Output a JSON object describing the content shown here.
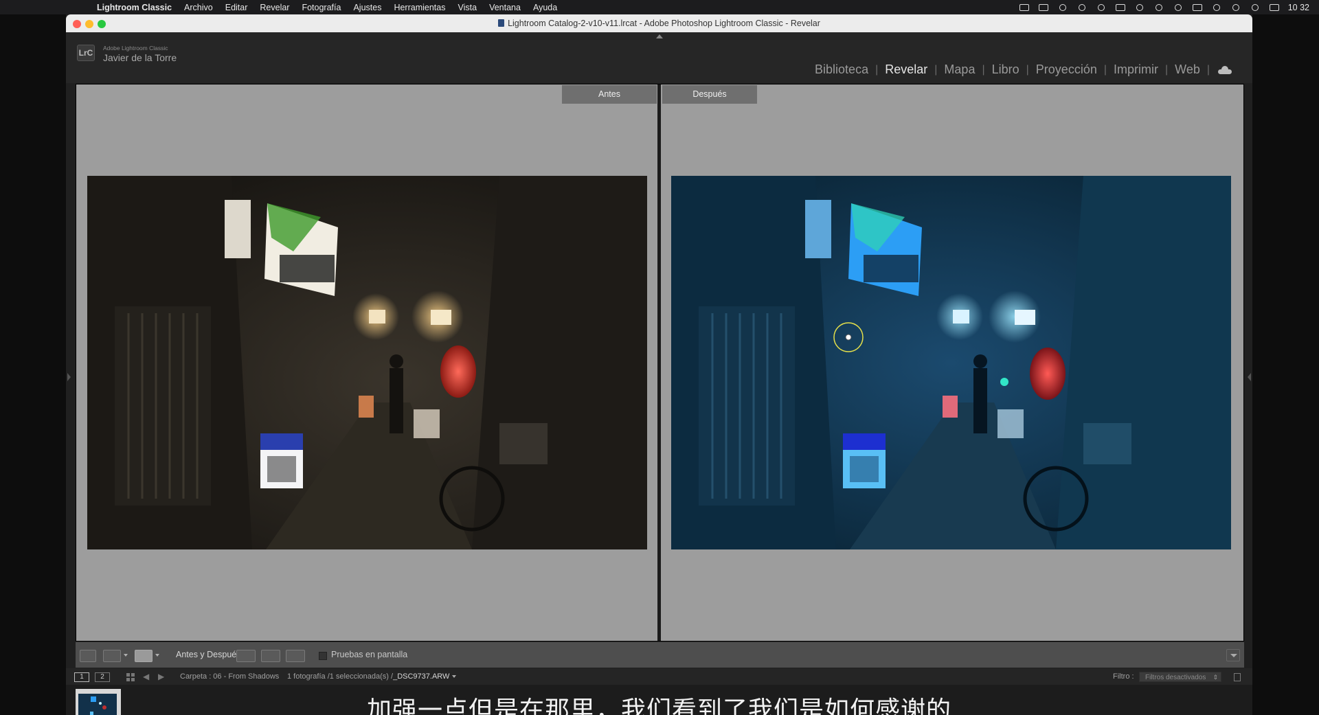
{
  "menubar": {
    "app": "Lightroom Classic",
    "items": [
      "Archivo",
      "Editar",
      "Revelar",
      "Fotografía",
      "Ajustes",
      "Herramientas",
      "Vista",
      "Ventana",
      "Ayuda"
    ],
    "clock": "10 32"
  },
  "window": {
    "title": "Lightroom Catalog-2-v10-v11.lrcat - Adobe Photoshop Lightroom Classic - Revelar"
  },
  "identity": {
    "badge": "LrC",
    "small": "Adobe Lightroom Classic",
    "name": "Javier de la Torre"
  },
  "modules": {
    "items": [
      "Biblioteca",
      "Revelar",
      "Mapa",
      "Libro",
      "Proyección",
      "Imprimir",
      "Web"
    ],
    "active": "Revelar"
  },
  "compare": {
    "before_label": "Antes",
    "after_label": "Después"
  },
  "toolbar": {
    "before_after_label": "Antes y Después:",
    "proof_label": "Pruebas en pantalla"
  },
  "filmbar": {
    "page1": "1",
    "page2": "2",
    "folder": "Carpeta : 06 - From Shadows",
    "count": "1 fotografía /1 seleccionada(s) /",
    "filename": "_DSC9737.ARW",
    "filter_label": "Filtro :",
    "filter_value": "Filtros desactivados"
  },
  "subtitle": "加强一点但是在那里，我们看到了我们是如何感谢的",
  "colors": {
    "workspace_bg": "#9d9d9d",
    "accent_active": "#e6e6e6",
    "before_tone": "#2a2620",
    "after_tone": "#0f3350"
  }
}
